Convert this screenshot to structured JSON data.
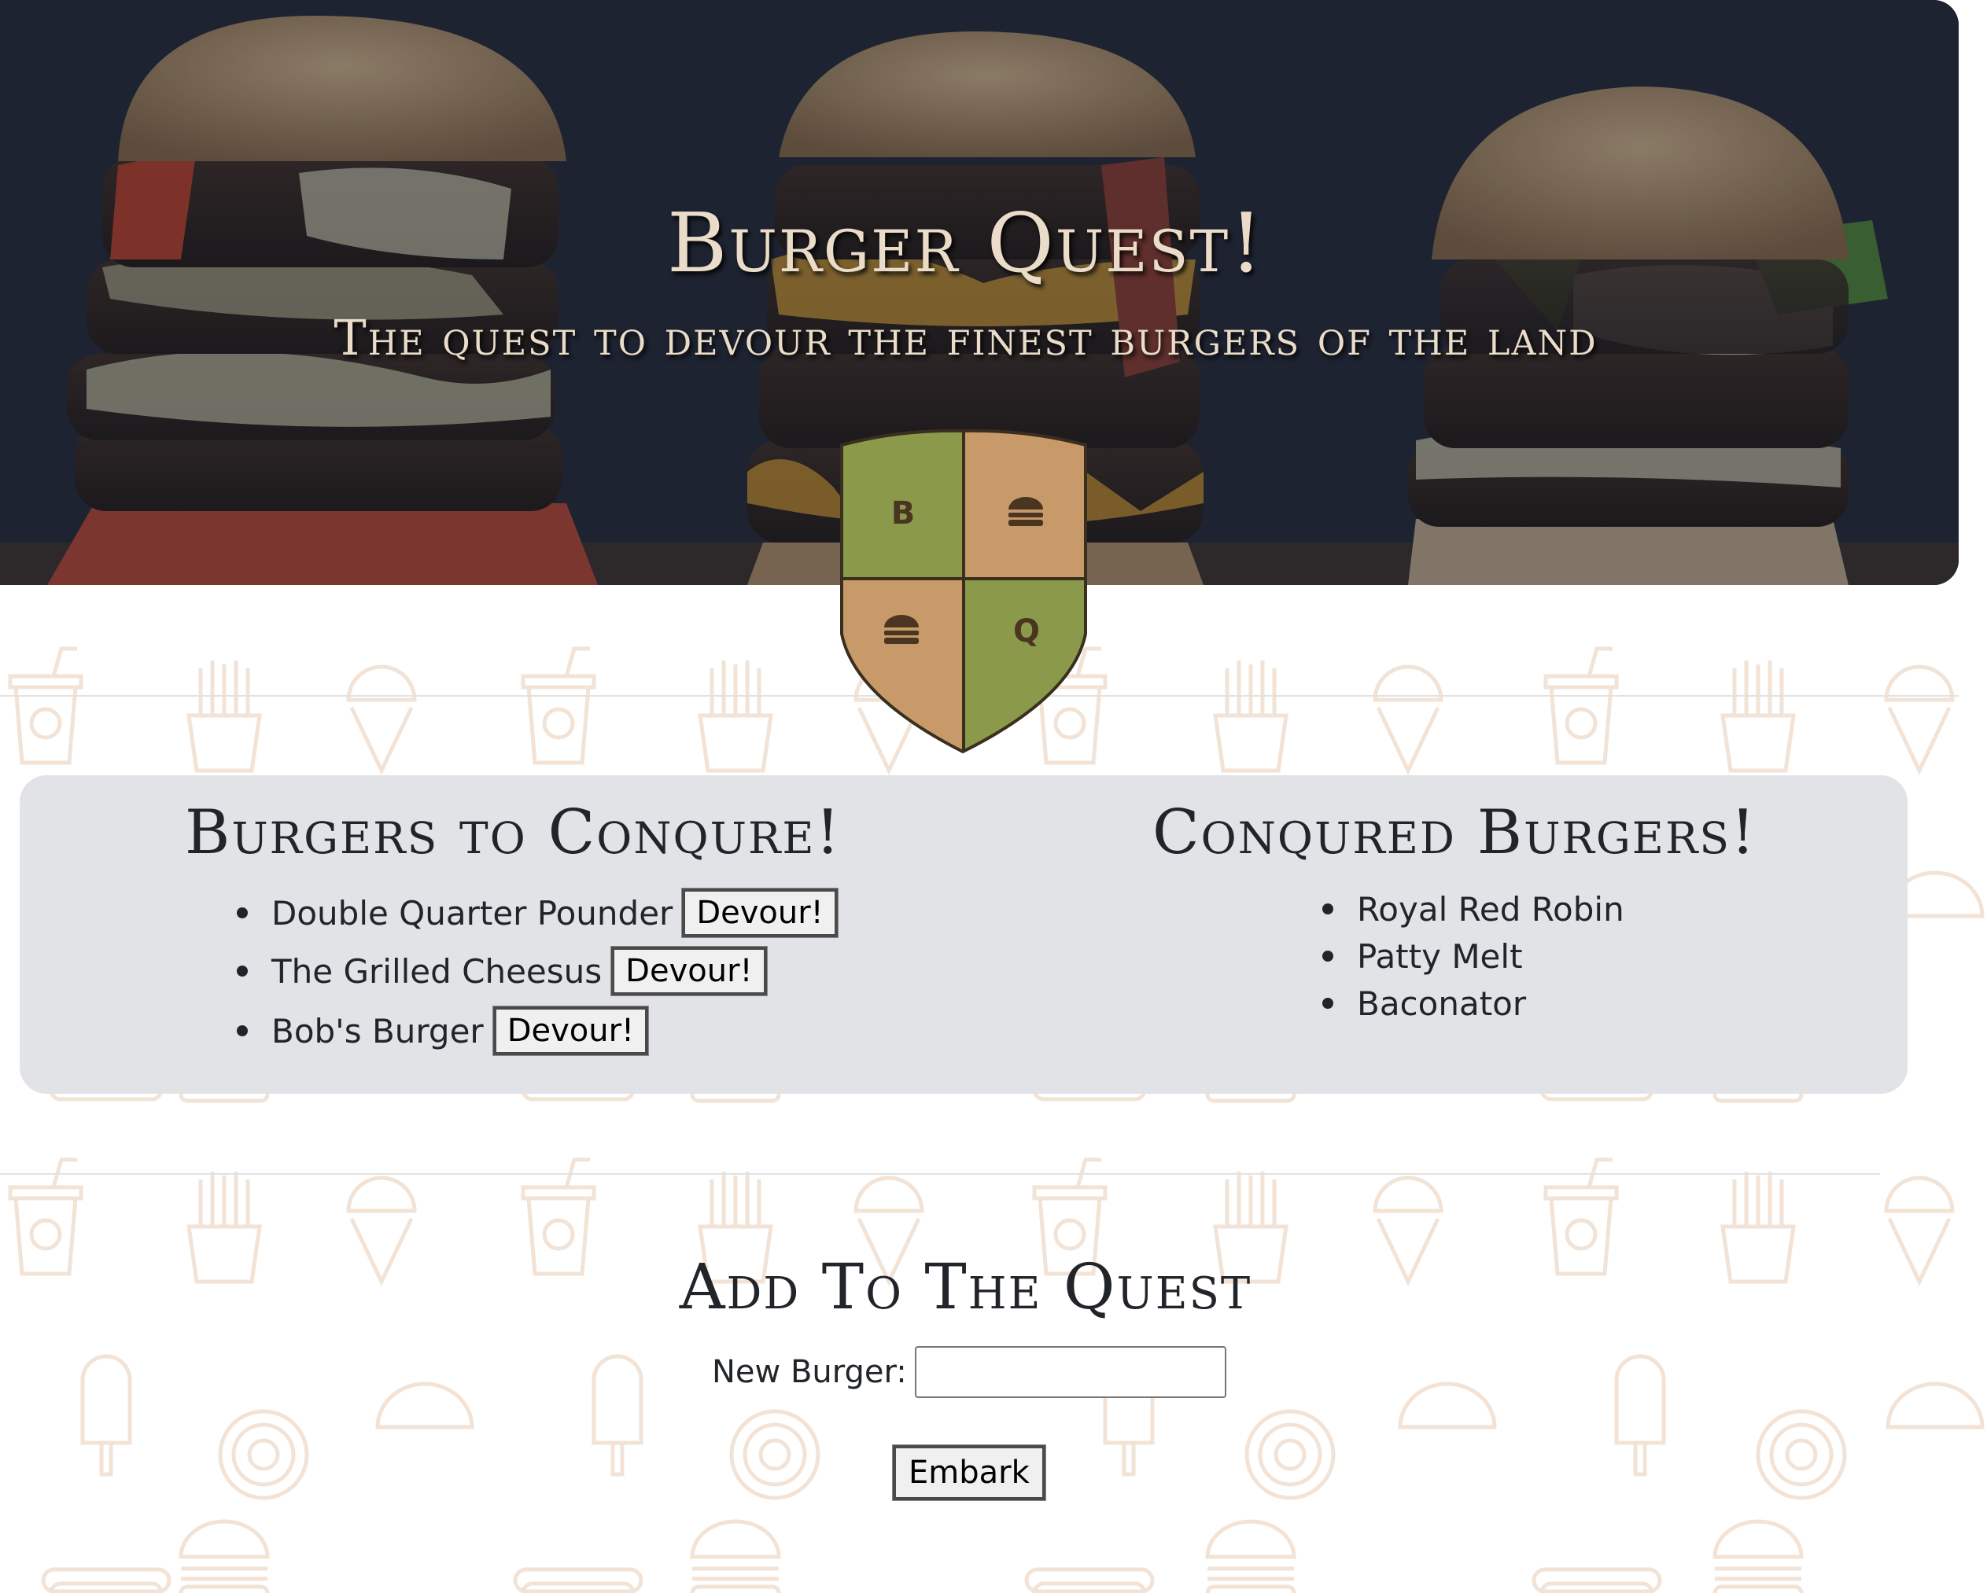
{
  "hero": {
    "title": "Burger Quest!",
    "subtitle": "The quest to devour the finest burgers of the land"
  },
  "crest": {
    "letters": [
      "B",
      "Q"
    ],
    "icon": "burger-icon",
    "colors": {
      "green": "#8a9a4a",
      "tan": "#c89a6a",
      "outline": "#3a2e1e"
    }
  },
  "to_conquer": {
    "title": "Burgers to Conqure!",
    "button_label": "Devour!",
    "items": [
      "Double Quarter Pounder",
      "The Grilled Cheesus",
      "Bob's Burger"
    ]
  },
  "conquered": {
    "title": "Conqured Burgers!",
    "items": [
      "Royal Red Robin",
      "Patty Melt",
      "Baconator"
    ]
  },
  "add": {
    "title": "Add To The Quest",
    "field_label": "New Burger:",
    "field_value": "",
    "submit_label": "Embark"
  },
  "background_icons": [
    "soda-cup-icon",
    "ice-cream-cone-icon",
    "fries-icon",
    "popsicle-icon",
    "taco-icon",
    "donut-icon",
    "burger-icon",
    "hotdog-icon"
  ],
  "colors": {
    "panel": "#e1e3e7",
    "pattern": "#f4e6da",
    "hero_text": "#eadcc8",
    "text": "#212529"
  }
}
